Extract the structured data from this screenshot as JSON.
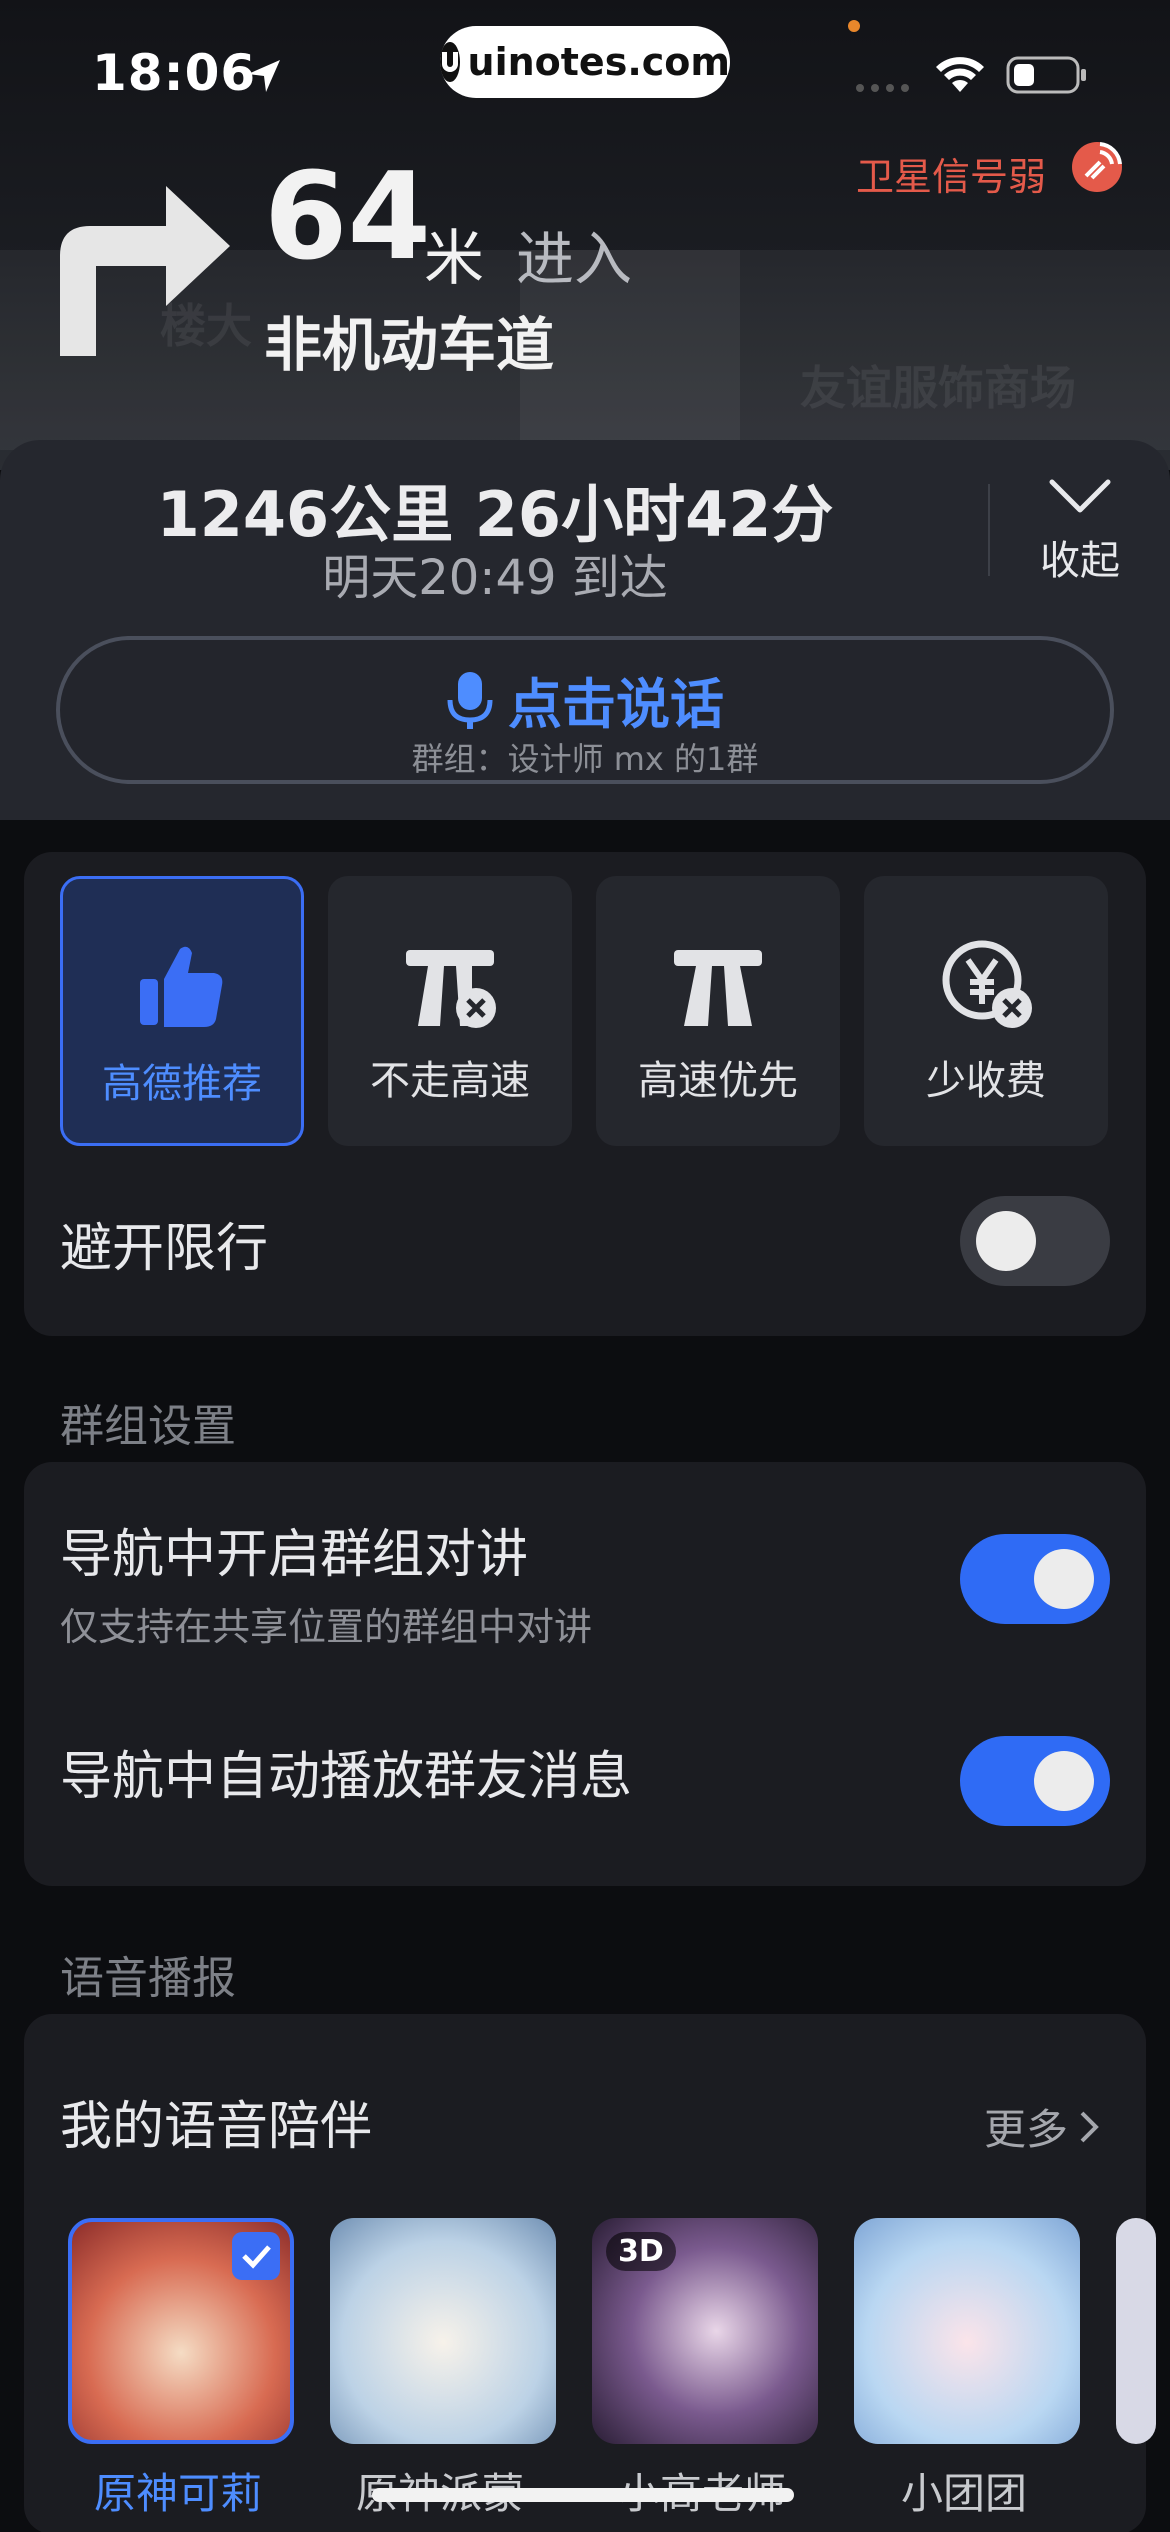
{
  "status_bar": {
    "time": "18:06",
    "watermark": "uinotes.com"
  },
  "navigation": {
    "gps_warning": "卫星信号弱",
    "distance": "64",
    "distance_unit": "米",
    "action": "进入",
    "road_name": "非机动车道",
    "map_labels": [
      "楼大",
      "友谊服饰商场"
    ]
  },
  "route": {
    "summary": "1246公里 26小时42分",
    "eta": "明天20:49 到达",
    "collapse_label": "收起",
    "talk_label": "点击说话",
    "talk_group": "群组：设计师 mx 的1群"
  },
  "route_options": [
    {
      "label": "高德推荐",
      "icon": "thumbs-up-icon",
      "selected": true
    },
    {
      "label": "不走高速",
      "icon": "no-highway-icon",
      "selected": false
    },
    {
      "label": "高速优先",
      "icon": "highway-icon",
      "selected": false
    },
    {
      "label": "少收费",
      "icon": "less-toll-icon",
      "selected": false
    }
  ],
  "avoid_restriction": {
    "label": "避开限行",
    "enabled": false
  },
  "group_settings": {
    "title": "群组设置",
    "intercom": {
      "label": "导航中开启群组对讲",
      "sub": "仅支持在共享位置的群组中对讲",
      "enabled": true
    },
    "auto_play": {
      "label": "导航中自动播放群友消息",
      "enabled": true
    }
  },
  "voice": {
    "title": "语音播报",
    "my_voices": "我的语音陪伴",
    "more": "更多",
    "items": [
      {
        "name": "原神可莉",
        "selected": true
      },
      {
        "name": "原神派蒙",
        "selected": false
      },
      {
        "name": "小高老师",
        "selected": false,
        "badge": "3D"
      },
      {
        "name": "小团团",
        "selected": false
      }
    ]
  },
  "colors": {
    "accent": "#3b6ef5",
    "accent_text": "#4e8dff",
    "warning": "#e45a4a"
  }
}
